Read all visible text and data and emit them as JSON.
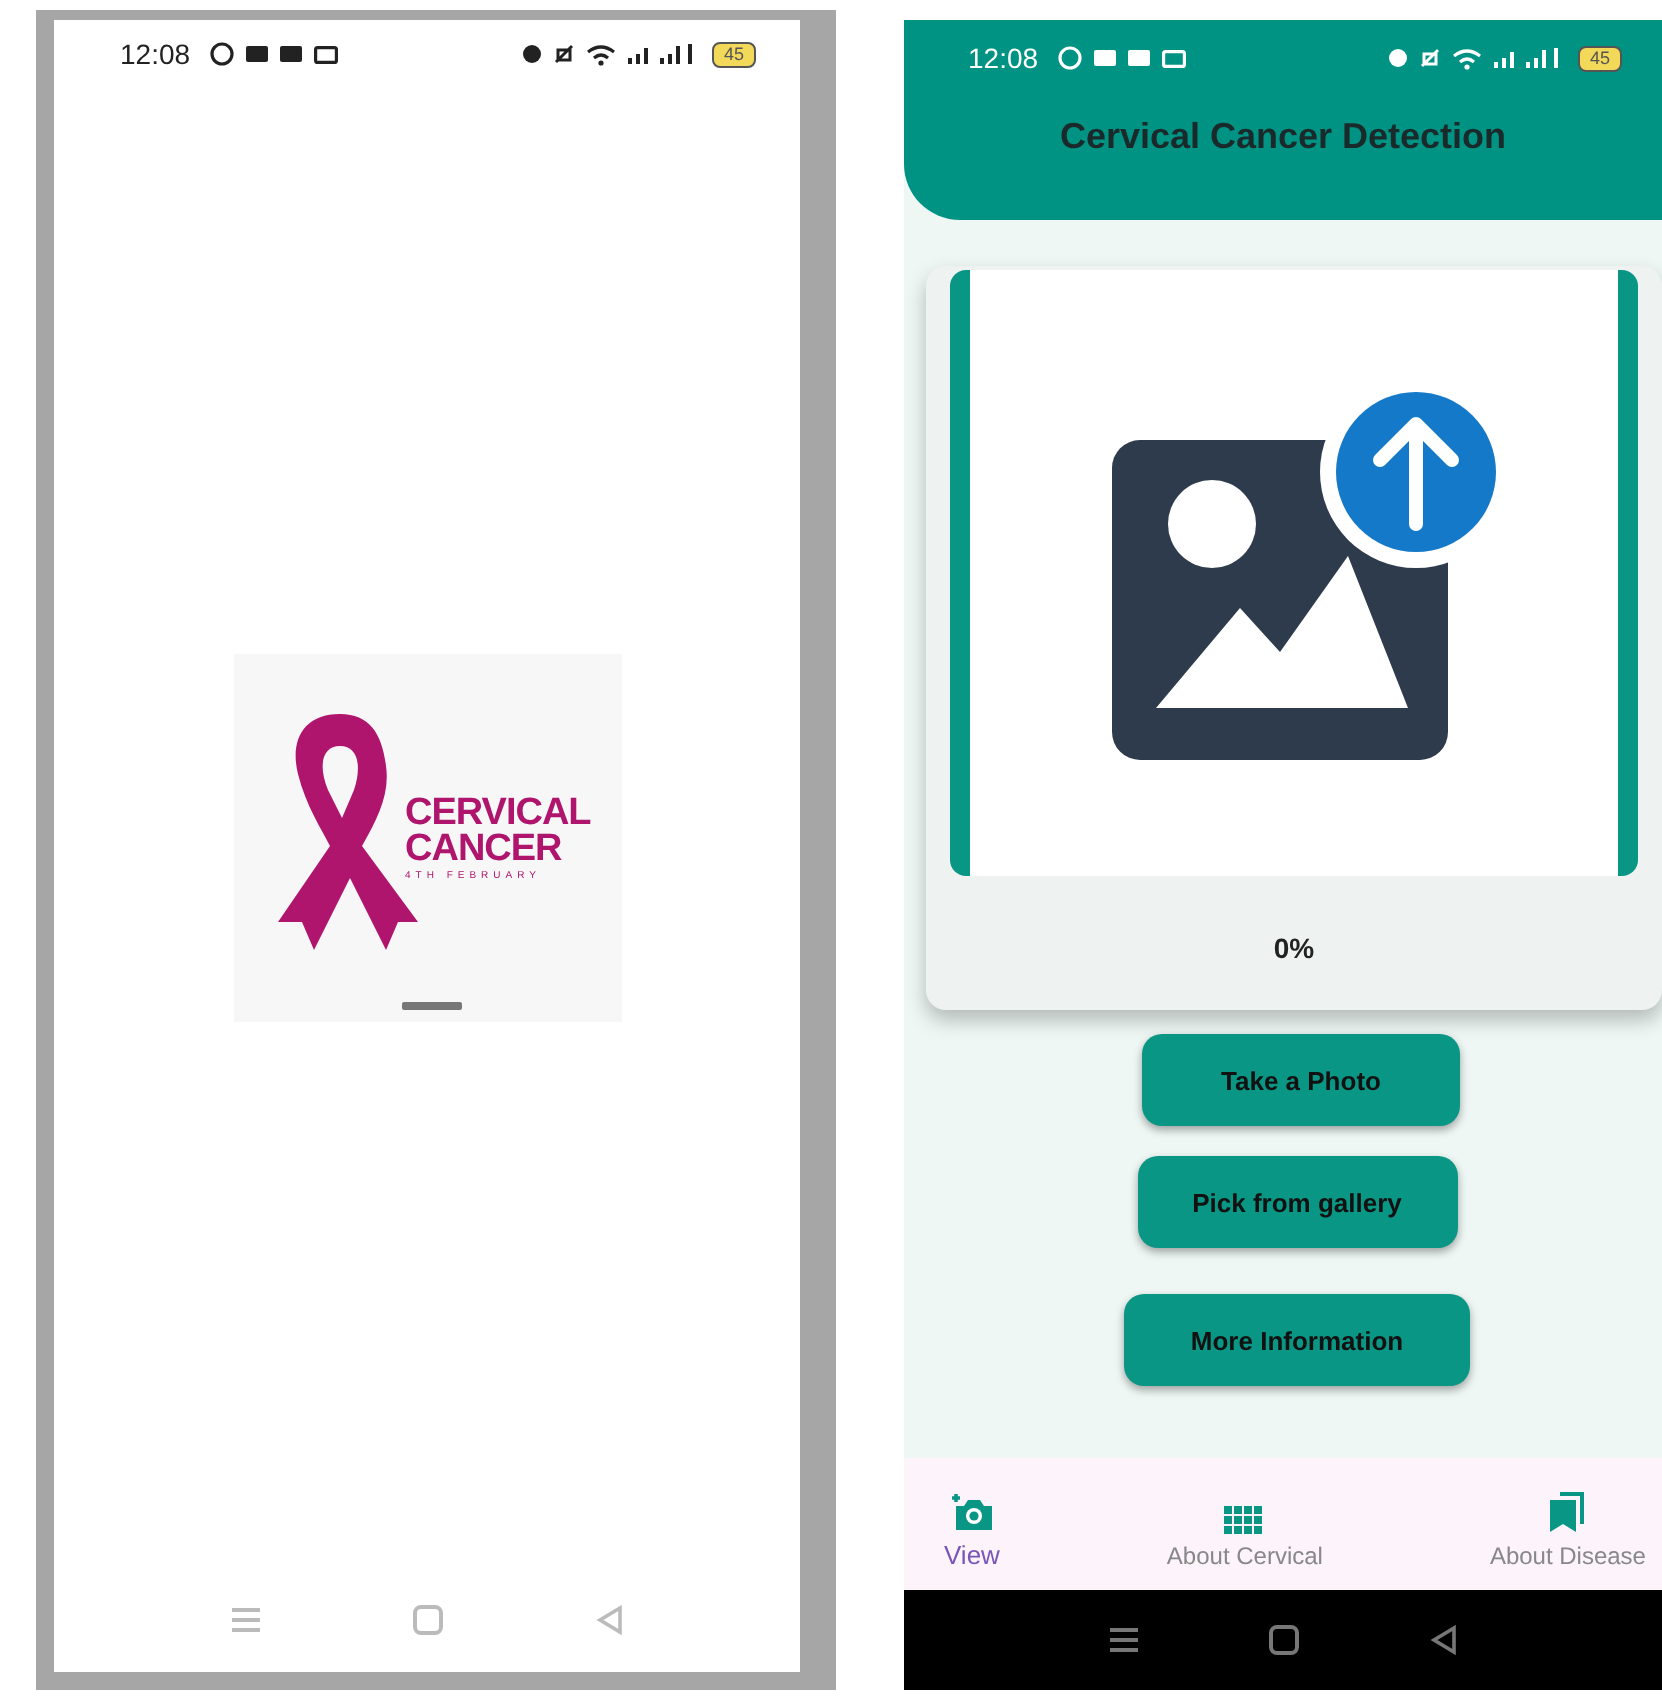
{
  "splash_screen": {
    "status_bar": {
      "time": "12:08",
      "battery": "45"
    },
    "logo": {
      "line_1": "CERVICAL",
      "line_2": "CANCER",
      "tagline": "4TH FEBRUARY"
    }
  },
  "main_screen": {
    "status_bar": {
      "time": "12:08",
      "battery": "45"
    },
    "title": "Cervical Cancer Detection",
    "upload": {
      "progress": "0%"
    },
    "buttons": [
      "Take a Photo",
      "Pick from gallery",
      "More Information"
    ],
    "bottom_nav": [
      {
        "label": "View",
        "kind": "camera",
        "selected": true
      },
      {
        "label": "About Cervical",
        "kind": "grid",
        "selected": false
      },
      {
        "label": "About Disease",
        "kind": "bookmarks",
        "selected": false
      }
    ]
  }
}
